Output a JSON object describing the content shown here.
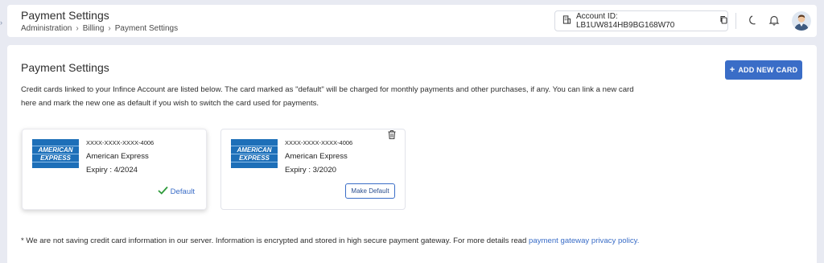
{
  "header": {
    "title": "Payment Settings",
    "breadcrumb": [
      "Administration",
      "Billing",
      "Payment Settings"
    ],
    "account_label": "Account ID: LB1UW814HB9BG168W70"
  },
  "main": {
    "title": "Payment Settings",
    "add_button": "ADD NEW CARD",
    "description": "Credit cards linked to your Infince Account are listed below. The card marked as \"default\" will be charged for monthly payments and other purchases, if any. You can link a new card here and mark the new one as default if you wish to switch the card used for payments.",
    "cards": [
      {
        "logo_line1": "AMERICAN",
        "logo_line2": "EXPRESS",
        "number": "XXXX-XXXX-XXXX-4006",
        "brand": "American Express",
        "expiry": "Expiry : 4/2024",
        "status": "Default"
      },
      {
        "logo_line1": "AMERICAN",
        "logo_line2": "EXPRESS",
        "number": "XXXX-XXXX-XXXX-4006",
        "brand": "American Express",
        "expiry": "Expiry : 3/2020",
        "action": "Make Default"
      }
    ],
    "footnote": "* We are not saving credit card information in our server. Information is encrypted and stored in high secure payment gateway. For more details read",
    "footnote_link": "payment gateway privacy policy."
  },
  "colors": {
    "accent": "#3a6dc7",
    "amex_blue": "#1d6fb8",
    "default_check": "#2e9a3a"
  },
  "icons": {
    "account": "building-icon",
    "copy": "copy-icon",
    "theme": "moon-icon",
    "notifications": "bell-icon",
    "delete": "trash-icon",
    "add": "plus-icon",
    "default": "check-icon"
  }
}
